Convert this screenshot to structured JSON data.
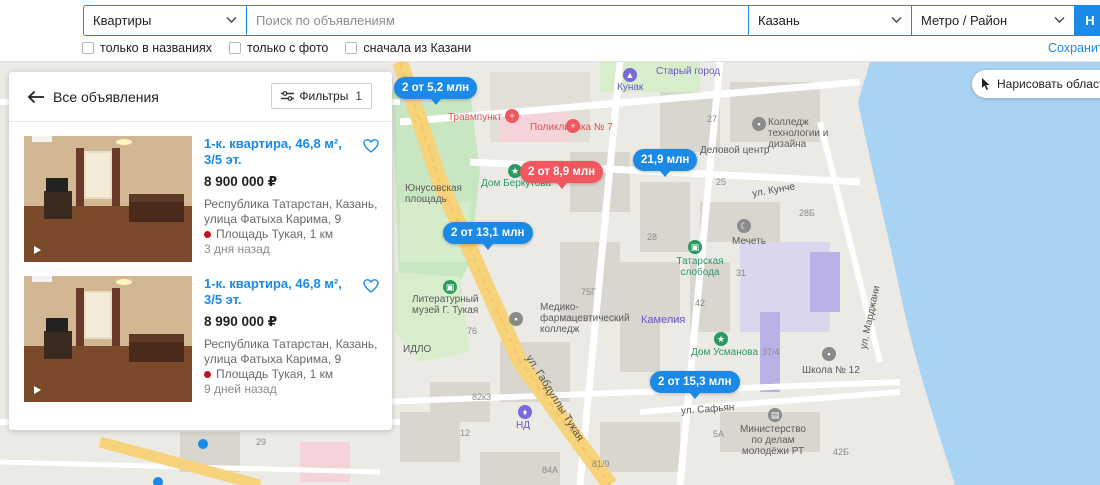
{
  "search": {
    "type_value": "Квартиры",
    "query_placeholder": "Поиск по объявлениям",
    "city_value": "Казань",
    "metro_value": "Метро / Район",
    "find_label": "Н"
  },
  "checks": [
    {
      "label": "только в названиях",
      "checked": false
    },
    {
      "label": "только с фото",
      "checked": false
    },
    {
      "label": "сначала из Казани",
      "checked": false
    }
  ],
  "save_label": "Сохранить",
  "panel": {
    "back_label": "Все объявления",
    "filters_label": "Фильтры",
    "filters_count": "1"
  },
  "listings": [
    {
      "title": "1-к. квартира, 46,8 м², 3/5 эт.",
      "price": "8 900 000 ₽",
      "address": "Республика Татарстан, Казань, улица Фатыха Карима, 9",
      "metro": "Площадь Тукая, 1 км",
      "time": "3 дня назад"
    },
    {
      "title": "1-к. квартира, 46,8 м², 3/5 эт.",
      "price": "8 990 000 ₽",
      "address": "Республика Татарстан, Казань, улица Фатыха Карима, 9",
      "metro": "Площадь Тукая, 1 км",
      "time": "9 дней назад"
    }
  ],
  "map": {
    "draw_label": "Нарисовать область",
    "pins": [
      {
        "label": "2 от 5,2 млн",
        "color": "#1a8ae6"
      },
      {
        "label": "2 от 8,9 млн",
        "color": "#f0585e"
      },
      {
        "label": "21,9 млн",
        "color": "#1a8ae6"
      },
      {
        "label": "2 от 13,1 млн",
        "color": "#1a8ae6"
      },
      {
        "label": "2 от 15,3 млн",
        "color": "#1a8ae6"
      }
    ],
    "labels": {
      "stary_gorod": "Старый город",
      "kunak": "Кунак",
      "travmpunkt": "Травмпункт",
      "poliklinika": "Поликлиника № 7",
      "college_tech": "Колледж технологии и дизайна",
      "delovoy": "Деловой центр",
      "dom_berkut": "Дом Беркутова",
      "yunusov": "Юнусовская площадь",
      "kunche": "ул. Кунче",
      "mechet": "Мечеть",
      "tatar_sloboda": "Татарская слобода",
      "lit_museum": "Литературный музей Г. Тукая",
      "med_college": "Медико-фармацевтический колледж",
      "kameliya": "Камелия",
      "dom_usmanova": "Дом Усманова",
      "idlo": "ИДЛО",
      "shkola": "Школа № 12",
      "gabdully": "ул. Габдуллы Тукая",
      "safyan": "ул. Сафьян",
      "mardzhani": "ул. Марджани",
      "nd": "НД",
      "ministry": "Министерство по делам молодёжи РТ",
      "n27": "27",
      "n25": "25",
      "n28": "28",
      "n28b": "28Б",
      "n31": "31",
      "n42": "42",
      "n75g": "75Г",
      "n76": "76",
      "n37_4": "37/4",
      "n82k3": "82к3",
      "n29": "29",
      "n5a": "5А",
      "n84a": "84А",
      "n81_9": "81/9",
      "n42b": "42Б",
      "n12": "12"
    }
  }
}
